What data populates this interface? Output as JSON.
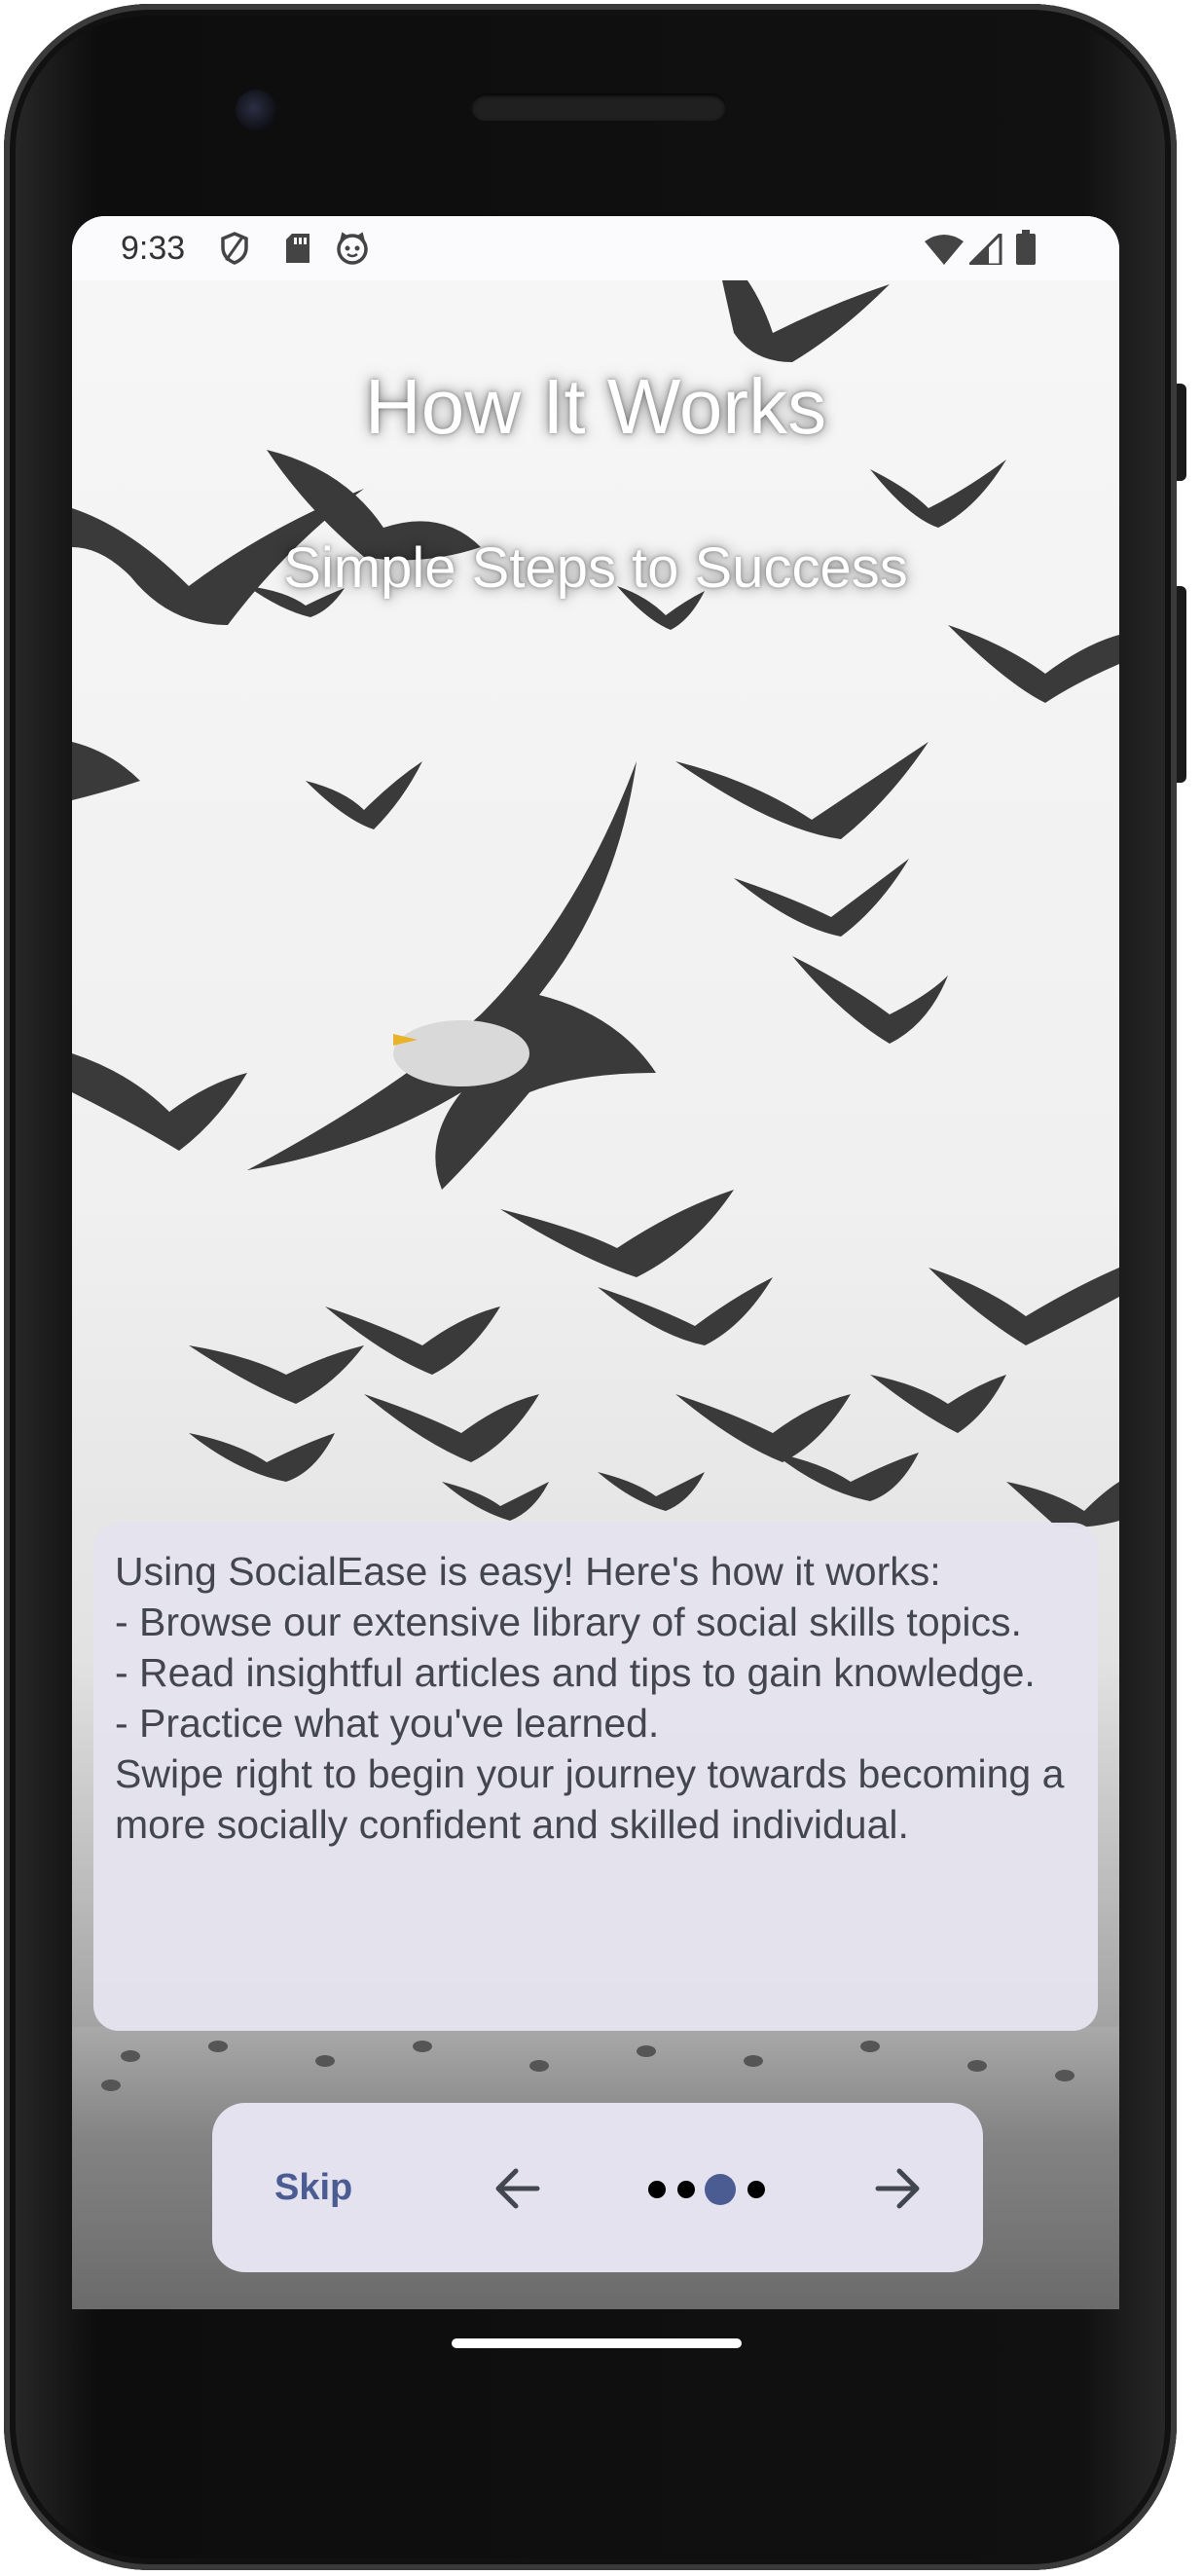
{
  "status_bar": {
    "time": "9:33"
  },
  "header": {
    "title": "How It Works",
    "subtitle": "Simple Steps to Success"
  },
  "content": {
    "lines": [
      "Using SocialEase is easy! Here's how it works:",
      "- Browse our extensive library of social skills topics.",
      "- Read insightful articles and tips to gain knowledge.",
      "- Practice what you've learned.",
      "Swipe right to begin your journey towards becoming a more socially confident and skilled individual."
    ]
  },
  "navigation": {
    "skip_label": "Skip",
    "page_indicator": {
      "total": 4,
      "current": 3
    }
  },
  "colors": {
    "accent": "#4b5c92",
    "card_background": "#e3e2ee",
    "text": "#44464f"
  },
  "icons": {
    "status": [
      "shield-icon",
      "sd-card-icon",
      "face-icon",
      "wifi-icon",
      "signal-icon",
      "battery-icon"
    ],
    "navigation": [
      "arrow-left-icon",
      "arrow-right-icon"
    ]
  }
}
